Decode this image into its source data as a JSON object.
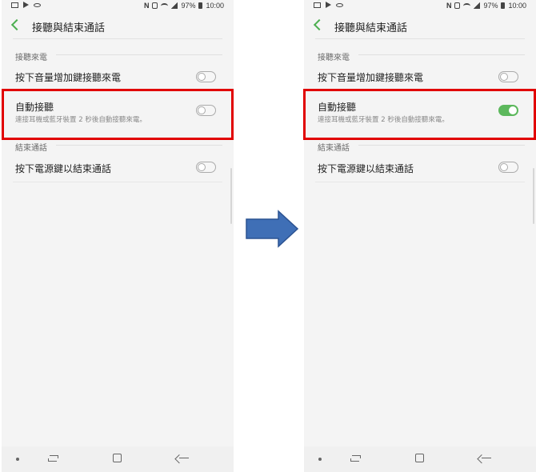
{
  "status": {
    "battery": "97%",
    "time": "10:00"
  },
  "header": {
    "title": "接聽與結束通話"
  },
  "sections": {
    "answer_label": "接聽來電",
    "end_label": "結束通話"
  },
  "items": {
    "volume_answer": "按下音量增加鍵接聽來電",
    "auto_answer": "自動接聽",
    "auto_answer_sub": "連接耳機或藍牙裝置 2 秒後自動接聽來電。",
    "power_end": "按下電源鍵以結束通話"
  },
  "screens": [
    {
      "auto_answer_on": false,
      "volume_answer_on": false,
      "power_end_on": false
    },
    {
      "auto_answer_on": true,
      "volume_answer_on": false,
      "power_end_on": false
    }
  ],
  "colors": {
    "accent": "#4caf50",
    "highlight": "#e10000",
    "arrow": "#3f6fb6"
  }
}
